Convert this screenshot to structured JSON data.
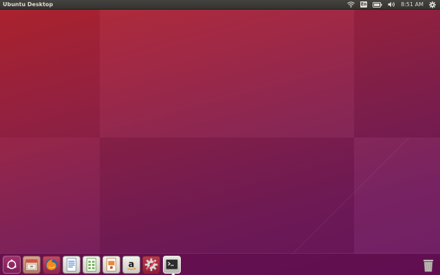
{
  "panel": {
    "title": "Ubuntu Desktop",
    "keyboard_layout": "En",
    "clock": "8:51 AM",
    "icons": [
      "wifi-icon",
      "keyboard-layout-indicator",
      "battery-icon",
      "volume-icon",
      "gear-icon"
    ]
  },
  "launcher": {
    "items": [
      {
        "name": "dash-home-button",
        "icon": "ubuntu-logo-icon"
      },
      {
        "name": "files-launcher",
        "icon": "file-cabinet-icon"
      },
      {
        "name": "firefox-launcher",
        "icon": "firefox-icon"
      },
      {
        "name": "writer-launcher",
        "icon": "writer-document-icon"
      },
      {
        "name": "calc-launcher",
        "icon": "spreadsheet-icon"
      },
      {
        "name": "impress-launcher",
        "icon": "presentation-icon"
      },
      {
        "name": "amazon-launcher",
        "icon": "amazon-icon"
      },
      {
        "name": "settings-launcher",
        "icon": "system-settings-icon"
      },
      {
        "name": "terminal-launcher",
        "icon": "terminal-icon",
        "running": true
      },
      {
        "name": "trash-launcher",
        "icon": "trash-icon"
      }
    ]
  },
  "colors": {
    "wallpaper_top": "#b3242e",
    "wallpaper_bottom": "#6a1660",
    "panel_bg": "#3c3b37",
    "ubuntu_orange": "#dd4814"
  }
}
